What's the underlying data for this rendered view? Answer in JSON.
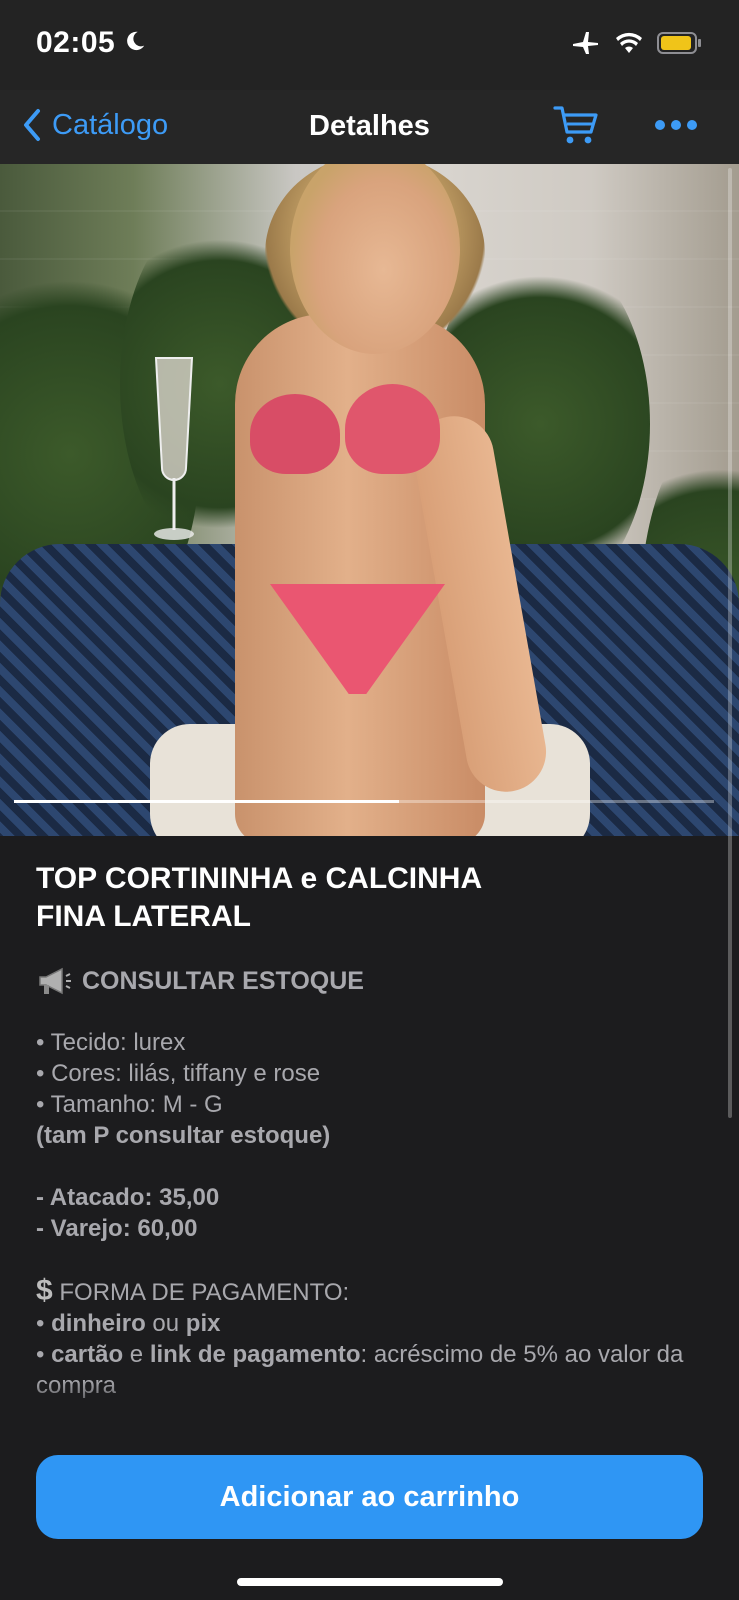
{
  "status_bar": {
    "time": "02:05",
    "icons": [
      "moon-icon",
      "airplane-icon",
      "wifi-icon",
      "battery-icon"
    ],
    "battery_color": "#f0c419"
  },
  "nav": {
    "back_label": "Catálogo",
    "title": "Detalhes",
    "accent": "#3d9bf6"
  },
  "gallery": {
    "image_description": "Product photo",
    "progress": 0.55
  },
  "product": {
    "title": "TOP CORTININHA e CALCINHA FINA LATERAL",
    "stock_label": "CONSULTAR ESTOQUE",
    "specs": [
      "• Tecido: lurex",
      "• Cores: lilás, tiffany e rose",
      "• Tamanho: M - G"
    ],
    "size_note": "(tam P consultar estoque)",
    "prices": [
      "- Atacado: 35,00",
      "- Varejo: 60,00"
    ],
    "payment_title": "FORMA DE PAGAMENTO:",
    "payment_1": {
      "bullet": "• ",
      "a": "dinheiro",
      "mid": " ou ",
      "b": "pix"
    },
    "payment_2": {
      "bullet": "• ",
      "a": "cartão",
      "mid": " e ",
      "b": "link de pagamento",
      "rest": ": acréscimo de 5% ao valor da compra"
    }
  },
  "cta": {
    "label": "Adicionar ao carrinho",
    "color": "#2f96f4"
  }
}
